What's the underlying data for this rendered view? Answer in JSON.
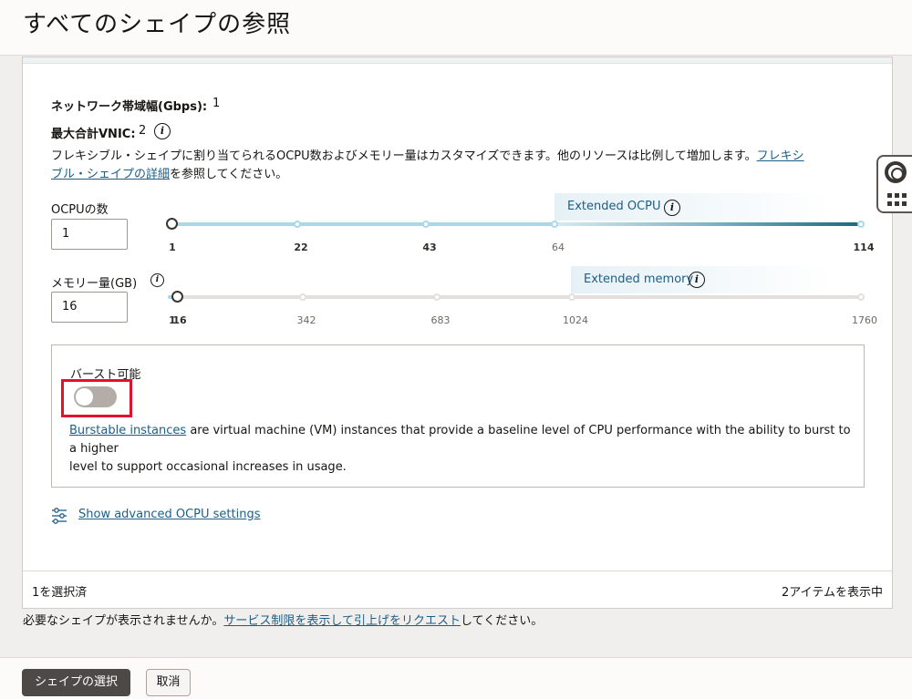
{
  "page": {
    "title": "すべてのシェイプの参照"
  },
  "shape_details": {
    "network_bandwidth_label": "ネットワーク帯域幅(Gbps):",
    "network_bandwidth_value": "1",
    "max_vnic_label": "最大合計VNIC:",
    "max_vnic_value": "2",
    "description_text": "フレキシブル・シェイプに割り当てられるOCPU数およびメモリー量はカスタマイズできます。他のリソースは比例して増加します。",
    "description_link_part1": "フレキシ",
    "description_link_part2": "ブル・シェイプの詳細",
    "description_suffix": "を参照してください。"
  },
  "ocpu": {
    "label": "OCPUの数",
    "value": "1",
    "extended_label": "Extended OCPU",
    "current": 1,
    "ticks": [
      "1",
      "22",
      "43",
      "64",
      "114"
    ]
  },
  "memory": {
    "label": "メモリー量(GB)",
    "value": "16",
    "extended_label": "Extended memory",
    "current": 16,
    "ticks": [
      "1",
      "16",
      "342",
      "683",
      "1024",
      "1760"
    ]
  },
  "burstable": {
    "label": "バースト可能",
    "enabled": false,
    "link_text": "Burstable instances",
    "text_line1": " are virtual machine (VM) instances that provide a baseline level of CPU performance with the ability to burst to a higher",
    "text_line2": "level to support occasional increases in usage."
  },
  "advanced_link": "Show advanced OCPU settings",
  "table_footer": {
    "selected": "1を選択済",
    "showing": "2アイテムを表示中"
  },
  "missing_shape": {
    "prefix": "必要なシェイプが表示されませんか。",
    "link": "サービス制限を表示して引上げをリクエスト",
    "suffix": "してください。"
  },
  "buttons": {
    "select_shape": "シェイプの選択",
    "cancel": "取消"
  },
  "colors": {
    "accent_link": "#1d5e85",
    "slider_active": "#a8d8ea",
    "slider_extended": "#1c6783",
    "toggle_highlight": "#e2112d",
    "primary_button": "#4d4946"
  }
}
